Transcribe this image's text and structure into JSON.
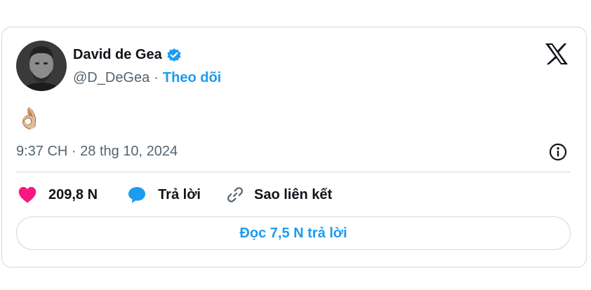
{
  "tweet": {
    "author": {
      "name": "David de Gea",
      "handle": "@D_DeGea",
      "verified": true,
      "avatar_icon": "profile-photo"
    },
    "separator": "·",
    "follow_label": "Theo dõi",
    "body": "👌🏼",
    "timestamp": "9:37 CH · 28 thg 10, 2024",
    "likes": "209,8 N",
    "reply_label": "Trả lời",
    "copy_link_label": "Sao liên kết",
    "read_replies_label": "Đọc 7,5 N trả lời"
  },
  "icons": {
    "brand": "x-logo-icon",
    "verified": "verified-badge-icon",
    "info": "info-icon",
    "like": "heart-icon",
    "reply": "speech-bubble-icon",
    "link": "link-icon"
  },
  "colors": {
    "accent": "#1d9bf0",
    "like": "#f91880",
    "text": "#0f1419",
    "muted": "#536471",
    "border": "#cfd9de"
  }
}
